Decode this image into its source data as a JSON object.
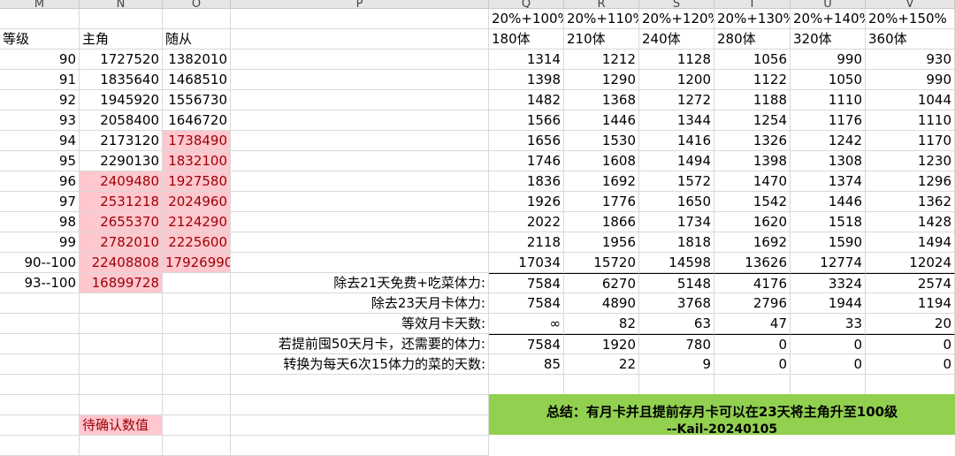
{
  "column_headers": [
    "M",
    "N",
    "O",
    "P",
    "Q",
    "R",
    "S",
    "T",
    "U",
    "V"
  ],
  "ratios": [
    "20%+100%",
    "20%+110%",
    "20%+120%",
    "20%+130%",
    "20%+140%",
    "20%+150%"
  ],
  "stamina": [
    "180体",
    "210体",
    "240体",
    "280体",
    "320体",
    "360体"
  ],
  "headers": {
    "level": "等级",
    "main": "主角",
    "follower": "随从"
  },
  "rows": [
    {
      "level": "90",
      "main": "1727520",
      "follower": "1382010",
      "vals": [
        "1314",
        "1212",
        "1128",
        "1056",
        "990",
        "930"
      ]
    },
    {
      "level": "91",
      "main": "1835640",
      "follower": "1468510",
      "vals": [
        "1398",
        "1290",
        "1200",
        "1122",
        "1050",
        "990"
      ]
    },
    {
      "level": "92",
      "main": "1945920",
      "follower": "1556730",
      "vals": [
        "1482",
        "1368",
        "1272",
        "1188",
        "1110",
        "1044"
      ]
    },
    {
      "level": "93",
      "main": "2058400",
      "follower": "1646720",
      "vals": [
        "1566",
        "1446",
        "1344",
        "1254",
        "1176",
        "1110"
      ]
    },
    {
      "level": "94",
      "main": "2173120",
      "follower": "1738490",
      "vals": [
        "1656",
        "1530",
        "1416",
        "1326",
        "1242",
        "1170"
      ]
    },
    {
      "level": "95",
      "main": "2290130",
      "follower": "1832100",
      "vals": [
        "1746",
        "1608",
        "1494",
        "1398",
        "1308",
        "1230"
      ]
    },
    {
      "level": "96",
      "main": "2409480",
      "follower": "1927580",
      "vals": [
        "1836",
        "1692",
        "1572",
        "1470",
        "1374",
        "1296"
      ]
    },
    {
      "level": "97",
      "main": "2531218",
      "follower": "2024960",
      "vals": [
        "1926",
        "1776",
        "1650",
        "1542",
        "1446",
        "1362"
      ]
    },
    {
      "level": "98",
      "main": "2655370",
      "follower": "2124290",
      "vals": [
        "2022",
        "1866",
        "1734",
        "1620",
        "1518",
        "1428"
      ]
    },
    {
      "level": "99",
      "main": "2782010",
      "follower": "2225600",
      "vals": [
        "2118",
        "1956",
        "1818",
        "1692",
        "1590",
        "1494"
      ]
    }
  ],
  "total_row": {
    "level": "90--100",
    "main": "22408808",
    "follower": "17926990",
    "vals": [
      "17034",
      "15720",
      "14598",
      "13626",
      "12774",
      "12024"
    ]
  },
  "range_row": {
    "level": "93--100",
    "main": "16899728"
  },
  "summary_rows": [
    {
      "label": "除去21天免费+吃菜体力:",
      "vals": [
        "7584",
        "6270",
        "5148",
        "4176",
        "3324",
        "2574"
      ]
    },
    {
      "label": "除去23天月卡体力:",
      "vals": [
        "7584",
        "4890",
        "3768",
        "2796",
        "1944",
        "1194"
      ]
    },
    {
      "label": "等效月卡天数:",
      "vals": [
        "∞",
        "82",
        "63",
        "47",
        "33",
        "20"
      ]
    },
    {
      "label": "若提前囤50天月卡，还需要的体力:",
      "vals": [
        "7584",
        "1920",
        "780",
        "0",
        "0",
        "0"
      ]
    },
    {
      "label": "转换为每天6次15体力的菜的天数:",
      "vals": [
        "85",
        "22",
        "9",
        "0",
        "0",
        "0"
      ]
    }
  ],
  "pending_label": "待确认数值",
  "conclusion": {
    "line1": "总结：有月卡并且提前存月卡可以在23天将主角升至100级",
    "line2": "--Kail-20240105"
  },
  "colors": {
    "pink_fill": "#ffc7ce",
    "pink_text": "#9c0006",
    "green_fill": "#92d050"
  }
}
